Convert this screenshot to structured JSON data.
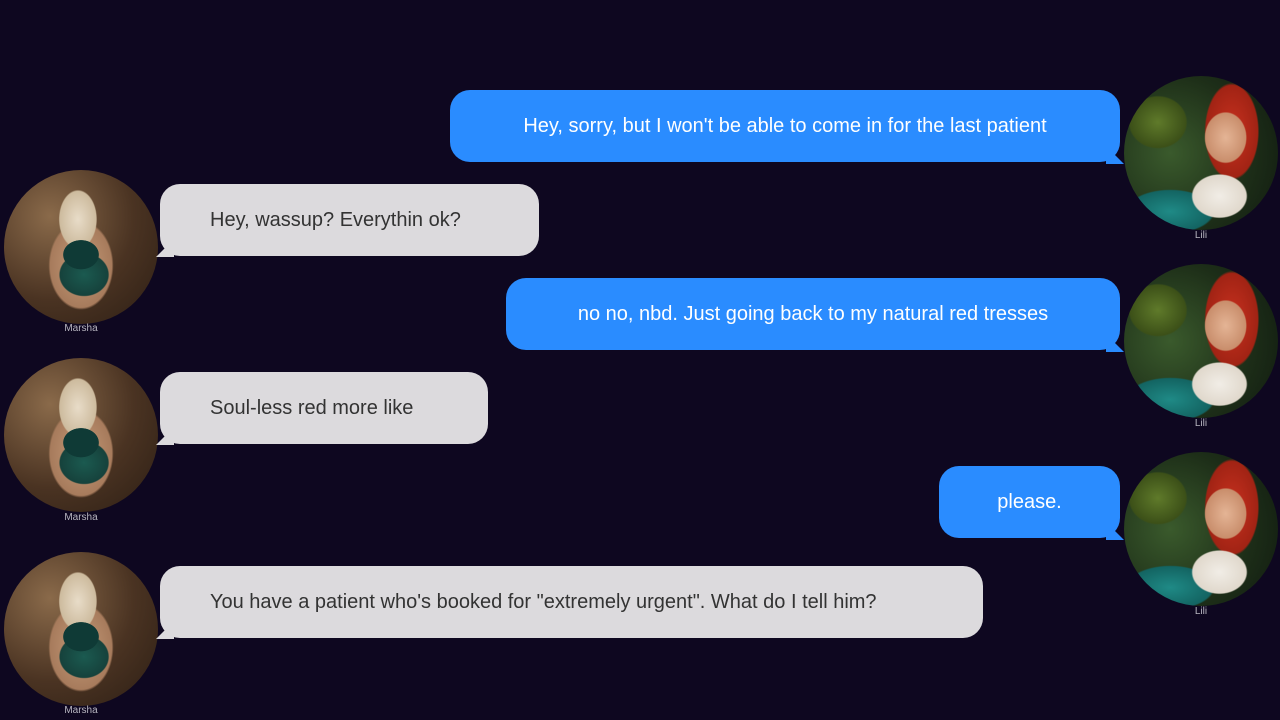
{
  "contacts": {
    "me": "Lili",
    "other": "Marsha"
  },
  "messages": [
    {
      "sender": "Lili",
      "direction": "outgoing",
      "text": "Hey, sorry, but I won't be able to come in for the last patient"
    },
    {
      "sender": "Marsha",
      "direction": "incoming",
      "text": "Hey, wassup? Everythin ok?"
    },
    {
      "sender": "Lili",
      "direction": "outgoing",
      "text": "no no, nbd. Just going back to my natural red tresses"
    },
    {
      "sender": "Marsha",
      "direction": "incoming",
      "text": "Soul-less red more like"
    },
    {
      "sender": "Lili",
      "direction": "outgoing",
      "text": "please."
    },
    {
      "sender": "Marsha",
      "direction": "incoming",
      "text": "You have a patient who's booked for \"extremely urgent\". What do I tell him?"
    }
  ],
  "colors": {
    "background": "#0e0720",
    "outgoing_bubble": "#2a8cff",
    "incoming_bubble": "#dcdadd"
  }
}
